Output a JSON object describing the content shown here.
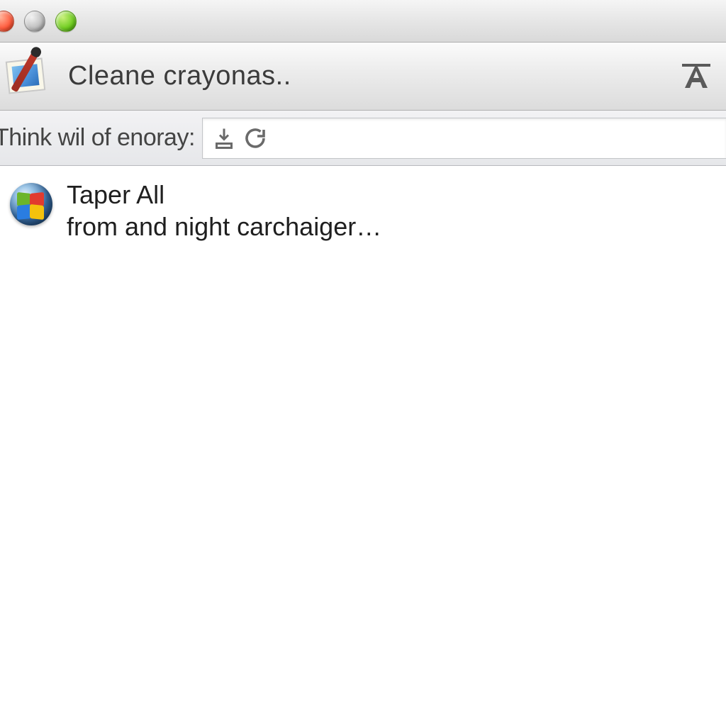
{
  "window": {
    "traffic_colors": {
      "close": "#ff5a3c",
      "min": "#bdbdbd",
      "zoom": "#6ecc1f"
    }
  },
  "toolbar": {
    "app_icon_name": "paint-app-icon",
    "title": "Cleane crayonas..",
    "right_tool_name": "text-tool-icon"
  },
  "searchbar": {
    "label": "Think wil of enoray:",
    "input_value": "",
    "icons": [
      "download-icon",
      "refresh-icon"
    ]
  },
  "list": {
    "items": [
      {
        "icon_name": "windows-logo-icon",
        "title": "Taper All",
        "subtitle": "from and night carchaiger…"
      }
    ]
  }
}
